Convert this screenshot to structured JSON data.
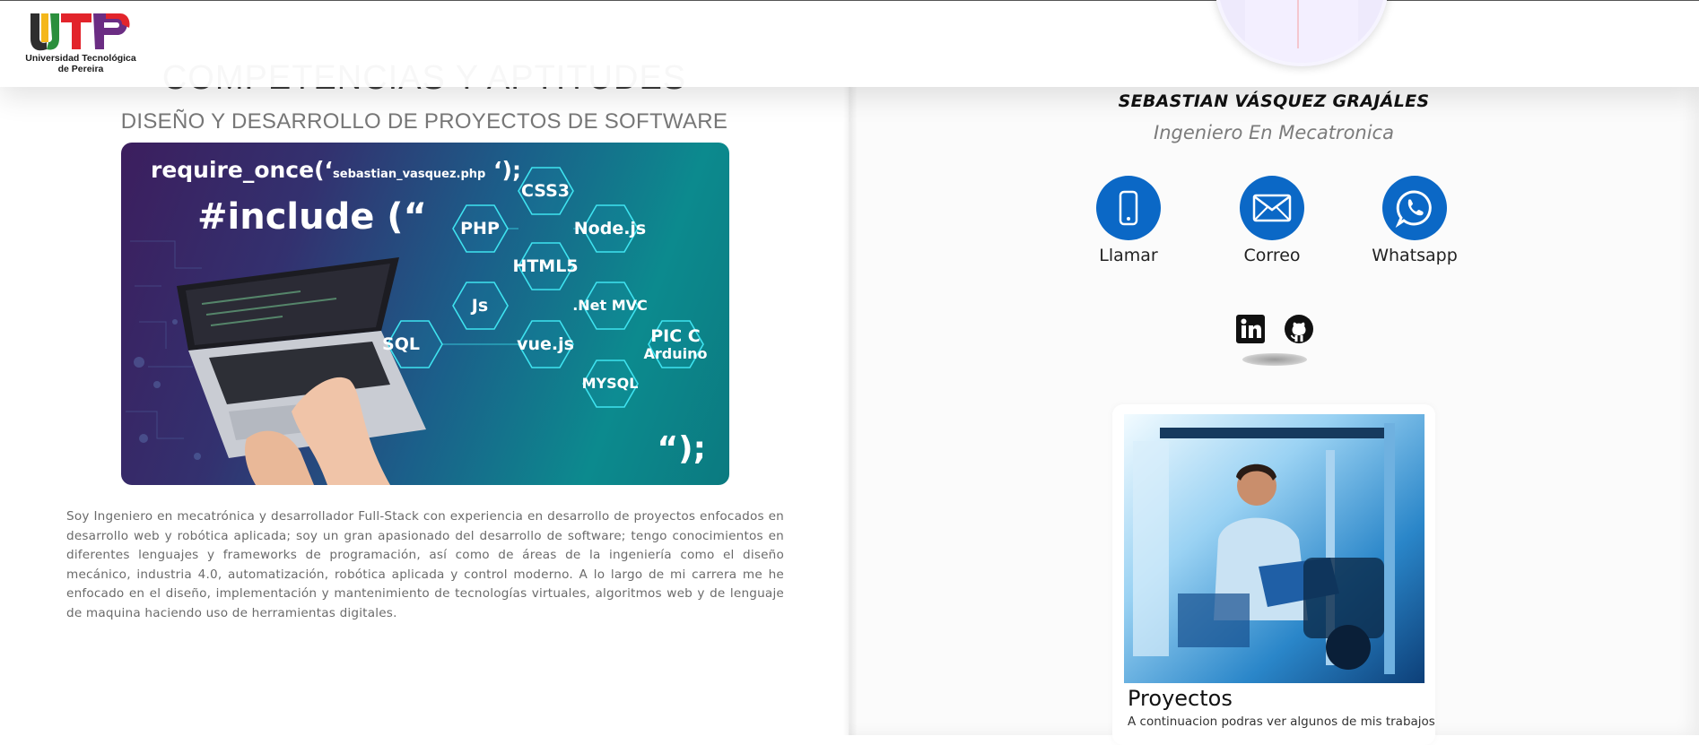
{
  "header": {
    "logo_text_line1": "Universidad Tecnológica",
    "logo_text_line2": "de Pereira",
    "colors": {
      "red": "#e2242b",
      "yellow": "#f4b71a",
      "green": "#2b8f3c",
      "purple": "#6b2d83",
      "dark": "#2e2e2e"
    }
  },
  "left": {
    "section_title": "COMPETENCIAS Y APTITUDES",
    "section_subtitle": "DISEÑO Y DESARROLLO DE PROYECTOS DE SOFTWARE",
    "hero": {
      "code_line1_a": "require_once(‘",
      "code_line1_file": "sebastian_vasquez.php",
      "code_line1_b": " ‘);",
      "code_line2": "#include (“",
      "code_end": "“);",
      "hex_labels": {
        "css3": "CSS3",
        "php": "PHP",
        "nodejs": "Node.js",
        "html5": "HTML5",
        "js": "Js",
        "netmvc": ".Net MVC",
        "sql": "SQL",
        "vuejs": "vue.js",
        "pic_c": "PIC C",
        "arduino": "Arduino",
        "mysql": "MYSQL"
      }
    },
    "bio": "Soy Ingeniero en mecatrónica y desarrollador Full-Stack con experiencia en desarrollo de proyectos enfocados en desarrollo web y robótica aplicada; soy un gran apasionado del desarrollo de software; tengo conocimientos en diferentes lenguajes y frameworks de programación, así como de áreas de la ingeniería como el diseño mecánico, industria 4.0, automatización, robótica aplicada y control moderno. A lo largo de mi carrera me he enfocado en el diseño, implementación y mantenimiento de tecnologías virtuales, algoritmos web y de lenguaje de maquina haciendo uso de herramientas digitales."
  },
  "right": {
    "name": "SEBASTIAN VÁSQUEZ GRAJÁLES",
    "role": "Ingeniero En Mecatronica",
    "contacts": [
      {
        "label": "Llamar",
        "icon": "phone-icon"
      },
      {
        "label": "Correo",
        "icon": "mail-icon"
      },
      {
        "label": "Whatsapp",
        "icon": "whatsapp-icon"
      }
    ],
    "social": [
      {
        "icon": "linkedin-icon"
      },
      {
        "icon": "github-icon"
      }
    ],
    "accent_color": "#0b68c6",
    "project_card": {
      "title": "Proyectos",
      "description": "A continuacion podras ver algunos de mis trabajos"
    }
  }
}
